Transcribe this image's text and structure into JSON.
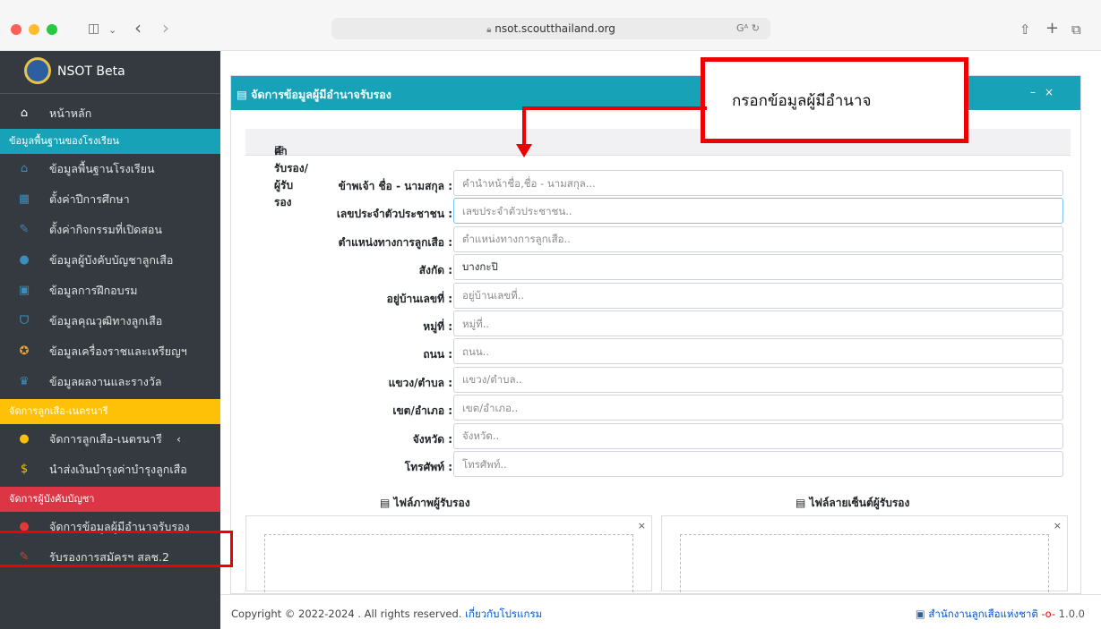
{
  "browser": {
    "url": "nsot.scoutthailand.org",
    "translate_icon": "Gᴬ",
    "reload_icon": "↻",
    "share_icon": "⇧",
    "newtab_icon": "+",
    "tabs_icon": "⧉",
    "sidebar_icon": "◫",
    "back_icon": "‹",
    "forward_icon": "›",
    "chev_icon": "⌄"
  },
  "sidebar": {
    "brand": "NSOT Beta",
    "home": {
      "label": "หน้าหลัก",
      "icon": "home-icon"
    },
    "section1": "ข้อมูลพื้นฐานของโรงเรียน",
    "items1": [
      {
        "label": "ข้อมูลพื้นฐานโรงเรียน",
        "glyph": "⌂",
        "color": "#3c8dbc",
        "icon": "school-icon"
      },
      {
        "label": "ตั้งค่าปีการศึกษา",
        "glyph": "▦",
        "color": "#3c8dbc",
        "icon": "calendar-icon"
      },
      {
        "label": "ตั้งค่ากิจกรรมที่เปิดสอน",
        "glyph": "✎",
        "color": "#3c8dbc",
        "icon": "edit-icon"
      },
      {
        "label": "ข้อมูลผู้บังคับบัญชาลูกเสือ",
        "glyph": "●",
        "color": "#3c8dbc",
        "icon": "users-icon"
      },
      {
        "label": "ข้อมูลการฝึกอบรม",
        "glyph": "▣",
        "color": "#3c8dbc",
        "icon": "id-card-icon"
      },
      {
        "label": "ข้อมูลคุณวุฒิทางลูกเสือ",
        "glyph": "ᗜ",
        "color": "#3c8dbc",
        "icon": "medal-icon"
      },
      {
        "label": "ข้อมูลเครื่องราชและเหรียญฯ",
        "glyph": "✪",
        "color": "#e8a33a",
        "icon": "award-icon"
      },
      {
        "label": "ข้อมูลผลงานและรางวัล",
        "glyph": "♛",
        "color": "#3c8dbc",
        "icon": "trophy-icon"
      }
    ],
    "section2": "จัดการลูกเสือ-เนตรนารี",
    "items2": [
      {
        "label": "จัดการลูกเสือ-เนตรนารี",
        "glyph": "●",
        "color": "#f4c20d",
        "icon": "scouts-icon",
        "arrow": "‹"
      },
      {
        "label": "นำส่งเงินบำรุงค่าบำรุงลูกเสือ",
        "glyph": "$",
        "color": "#f4c20d",
        "icon": "money-icon"
      }
    ],
    "section3": "จัดการผู้บังคับบัญชา",
    "items3": [
      {
        "label": "จัดการข้อมูลผู้มีอำนาจรับรอง",
        "glyph": "●",
        "color": "#e03a3a",
        "icon": "user-edit-icon"
      },
      {
        "label": "รับรองการสมัครฯ สลช.2",
        "glyph": "✎",
        "color": "#e03a3a",
        "icon": "edit-icon"
      }
    ]
  },
  "card": {
    "title": "จัดการข้อมูลผู้มีอำนาจรับรอง",
    "minimize": "–",
    "close": "×",
    "subtitle": "คำรับรอง/ผู้รับรอง"
  },
  "form": [
    {
      "label": "ข้าพเจ้า ชื่อ - นามสกุล :",
      "value": "",
      "placeholder": "คำนำหน้าชื่อ,ชื่อ - นามสกุล..."
    },
    {
      "label": "เลขประจำตัวประชาชน :",
      "value": "",
      "placeholder": "เลขประจำตัวประชาชน.."
    },
    {
      "label": "ตำแหน่งทางการลูกเสือ :",
      "value": "",
      "placeholder": "ตำแหน่งทางการลูกเสือ.."
    },
    {
      "label": "สังกัด :",
      "value": "บางกะปิ",
      "placeholder": ""
    },
    {
      "label": "อยู่บ้านเลขที่ :",
      "value": "",
      "placeholder": "อยู่บ้านเลขที่.."
    },
    {
      "label": "หมู่ที่ :",
      "value": "",
      "placeholder": "หมู่ที่.."
    },
    {
      "label": "ถนน :",
      "value": "",
      "placeholder": "ถนน.."
    },
    {
      "label": "แขวง/ตำบล :",
      "value": "",
      "placeholder": "แขวง/ตำบล.."
    },
    {
      "label": "เขต/อำเภอ :",
      "value": "",
      "placeholder": "เขต/อำเภอ.."
    },
    {
      "label": "จังหวัด :",
      "value": "",
      "placeholder": "จังหวัด.."
    },
    {
      "label": "โทรศัพท์ :",
      "value": "",
      "placeholder": "โทรศัพท์.."
    }
  ],
  "files": {
    "photo_title": "ไฟล์ภาพผู้รับรอง",
    "signature_title": "ไฟล์ลายเซ็นต์ผู้รับรอง",
    "remove": "×"
  },
  "footer": {
    "copyright": "Copyright © 2022-2024 . All rights reserved. ",
    "about_link": "เกี่ยวกับโปรแกรม",
    "org": "สำนักงานลูกเสือแห่งชาติ",
    "version": "1.0.0"
  },
  "callout": "กรอกข้อมูลผู้มีอำนาจ"
}
